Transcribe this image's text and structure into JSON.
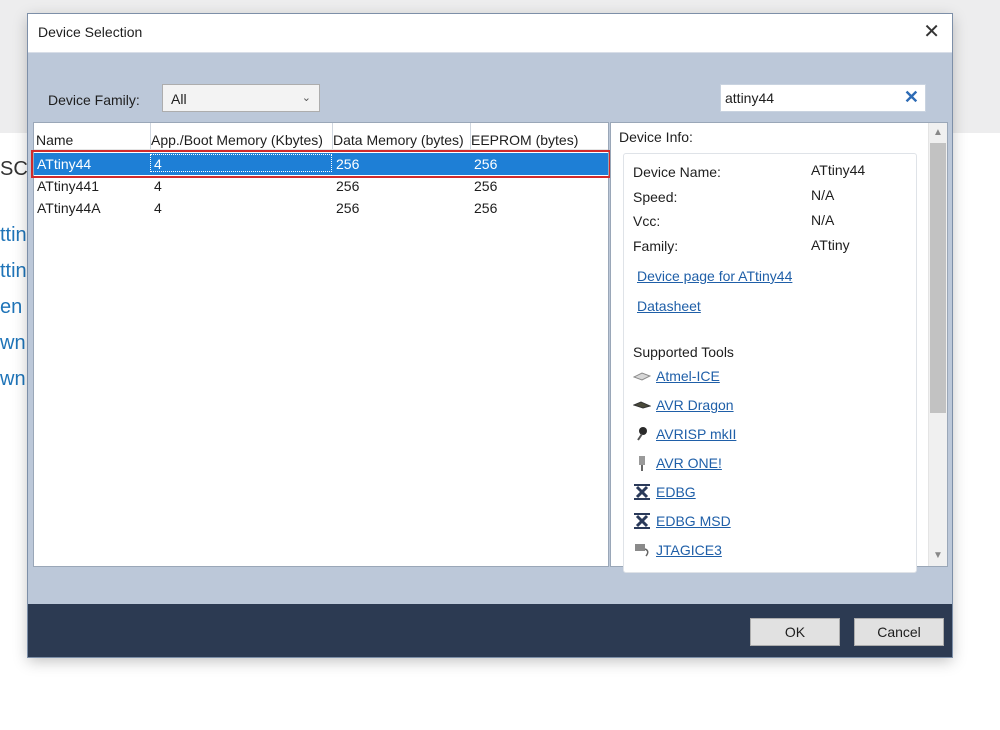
{
  "background": {
    "heading_fragment": "SC",
    "links": [
      "ttin",
      "ttin",
      "en",
      "wn",
      "wn"
    ]
  },
  "dialog": {
    "title": "Device Selection",
    "close_glyph": "✕",
    "family_label": "Device Family:",
    "family_value": "All",
    "search_value": "attiny44",
    "search_clear_glyph": "✕"
  },
  "table": {
    "columns": [
      "Name",
      "App./Boot Memory (Kbytes)",
      "Data Memory (bytes)",
      "EEPROM (bytes)"
    ],
    "rows": [
      [
        "ATtiny44",
        "4",
        "256",
        "256"
      ],
      [
        "ATtiny441",
        "4",
        "256",
        "256"
      ],
      [
        "ATtiny44A",
        "4",
        "256",
        "256"
      ]
    ],
    "selected_index": 0
  },
  "info": {
    "title": "Device Info:",
    "fields": [
      {
        "label": "Device Name:",
        "value": "ATtiny44"
      },
      {
        "label": "Speed:",
        "value": "N/A"
      },
      {
        "label": "Vcc:",
        "value": "N/A"
      },
      {
        "label": "Family:",
        "value": "ATtiny"
      }
    ],
    "device_page_link": "Device page for ATtiny44",
    "datasheet_link": "Datasheet",
    "tools_title": "Supported Tools",
    "tools": [
      {
        "name": "Atmel-ICE",
        "icon": "atmel-ice-icon"
      },
      {
        "name": "AVR Dragon",
        "icon": "avr-dragon-icon"
      },
      {
        "name": "AVRISP mkII",
        "icon": "avrisp-icon"
      },
      {
        "name": "AVR ONE!",
        "icon": "avr-one-icon"
      },
      {
        "name": "EDBG",
        "icon": "edbg-icon"
      },
      {
        "name": "EDBG MSD",
        "icon": "edbg-msd-icon"
      },
      {
        "name": "JTAGICE3",
        "icon": "jtagice3-icon"
      }
    ]
  },
  "footer": {
    "ok_label": "OK",
    "cancel_label": "Cancel"
  },
  "colors": {
    "dialog_bg": "#bcc8d9",
    "footer_bg": "#2c3a52",
    "selection": "#1e7fd6",
    "highlight": "#d12b2b",
    "link": "#1f5fa8"
  }
}
